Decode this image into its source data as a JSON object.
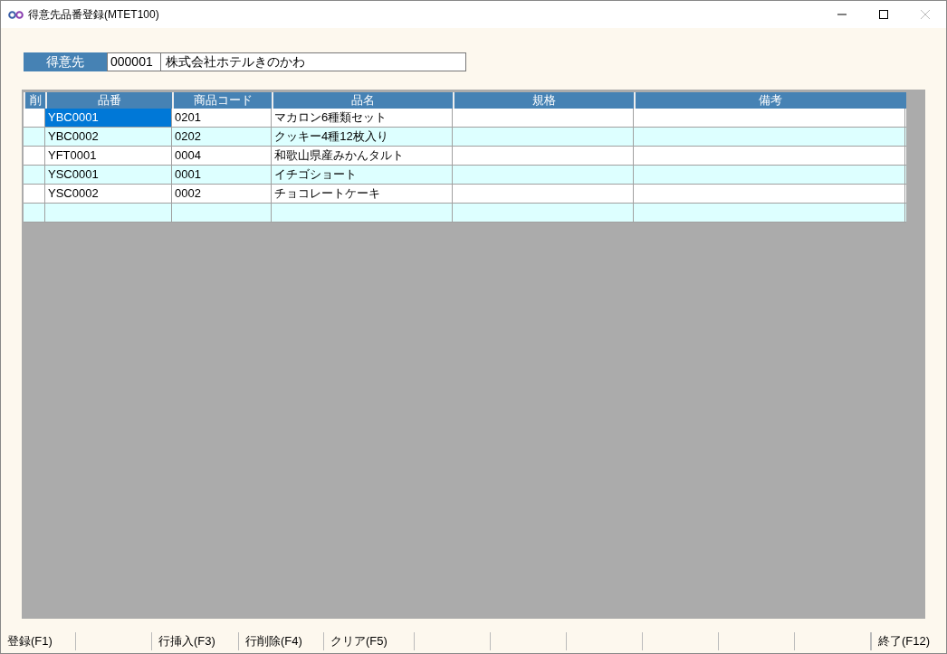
{
  "window": {
    "title": "得意先品番登録(MTET100)"
  },
  "customer": {
    "label": "得意先",
    "code": "000001",
    "name": "株式会社ホテルきのかわ"
  },
  "table": {
    "columns": [
      "削",
      "品番",
      "商品コード",
      "品名",
      "規格",
      "備考"
    ],
    "rows": [
      {
        "part_no": "YBC0001",
        "product_code": "0201",
        "name": "マカロン6種類セット",
        "selected": true
      },
      {
        "part_no": "YBC0002",
        "product_code": "0202",
        "name": "クッキー4種12枚入り",
        "selected": false
      },
      {
        "part_no": "YFT0001",
        "product_code": "0004",
        "name": "和歌山県産みかんタルト",
        "selected": false
      },
      {
        "part_no": "YSC0001",
        "product_code": "0001",
        "name": "イチゴショート",
        "selected": false
      },
      {
        "part_no": "YSC0002",
        "product_code": "0002",
        "name": "チョコレートケーキ",
        "selected": false
      },
      {
        "selected": false
      }
    ]
  },
  "function_keys": [
    {
      "kind": "key",
      "label": "登録(F1)"
    },
    {
      "kind": "blank"
    },
    {
      "kind": "key",
      "label": "行挿入(F3)"
    },
    {
      "kind": "key",
      "label": "行削除(F4)"
    },
    {
      "kind": "key",
      "label": "クリア(F5)"
    },
    {
      "kind": "blank"
    },
    {
      "kind": "blank"
    },
    {
      "kind": "blank"
    },
    {
      "kind": "blank"
    },
    {
      "kind": "blank"
    },
    {
      "kind": "blank"
    },
    {
      "kind": "key",
      "label": "終了(F12)"
    }
  ]
}
